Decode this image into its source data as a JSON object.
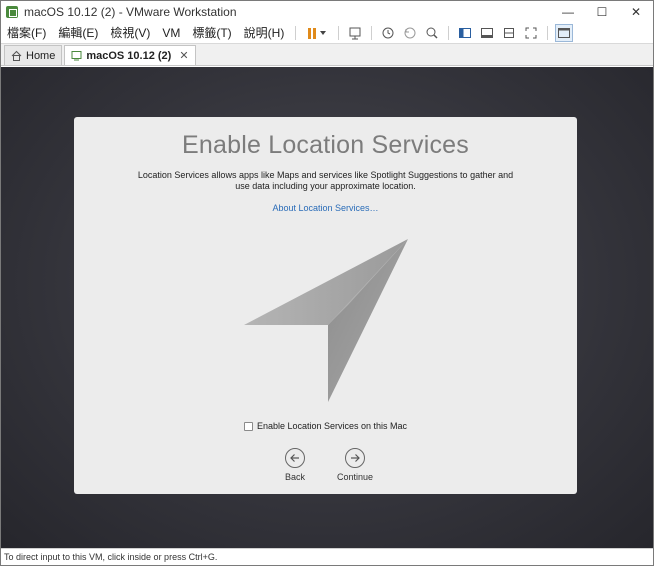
{
  "window": {
    "title": "macOS 10.12 (2) - VMware Workstation",
    "icon": "vmware-app-icon",
    "controls": {
      "minimize": "—",
      "maximize": "☐",
      "close": "✕"
    }
  },
  "menu": {
    "items": [
      "檔案(F)",
      "編輯(E)",
      "檢視(V)",
      "VM",
      "標籤(T)",
      "說明(H)"
    ]
  },
  "toolbar": {
    "icons": [
      "pause-icon",
      "send-keys-icon",
      "snapshot-icon",
      "revert-snapshot-icon",
      "snapshot-manager-icon",
      "sidebar-view-icon",
      "console-view-icon",
      "fit-window-icon",
      "full-screen-icon",
      "thumbnail-view-icon"
    ],
    "accent": "#e08a1a"
  },
  "tabs": [
    {
      "label": "Home",
      "icon": "home-icon",
      "active": false
    },
    {
      "label": "macOS 10.12 (2)",
      "icon": "vm-icon",
      "active": true,
      "close": "✕"
    }
  ],
  "setup": {
    "title": "Enable Location Services",
    "description": "Location Services allows apps like Maps and services like Spotlight Suggestions to gather and use data including your approximate location.",
    "link": "About Location Services…",
    "icon": "location-arrow-icon",
    "checkbox_label": "Enable Location Services on this Mac",
    "back_label": "Back",
    "continue_label": "Continue",
    "link_color": "#2a6cb8",
    "title_color": "#7c7c7c"
  },
  "status": {
    "text": "To direct input to this VM, click inside or press Ctrl+G."
  }
}
